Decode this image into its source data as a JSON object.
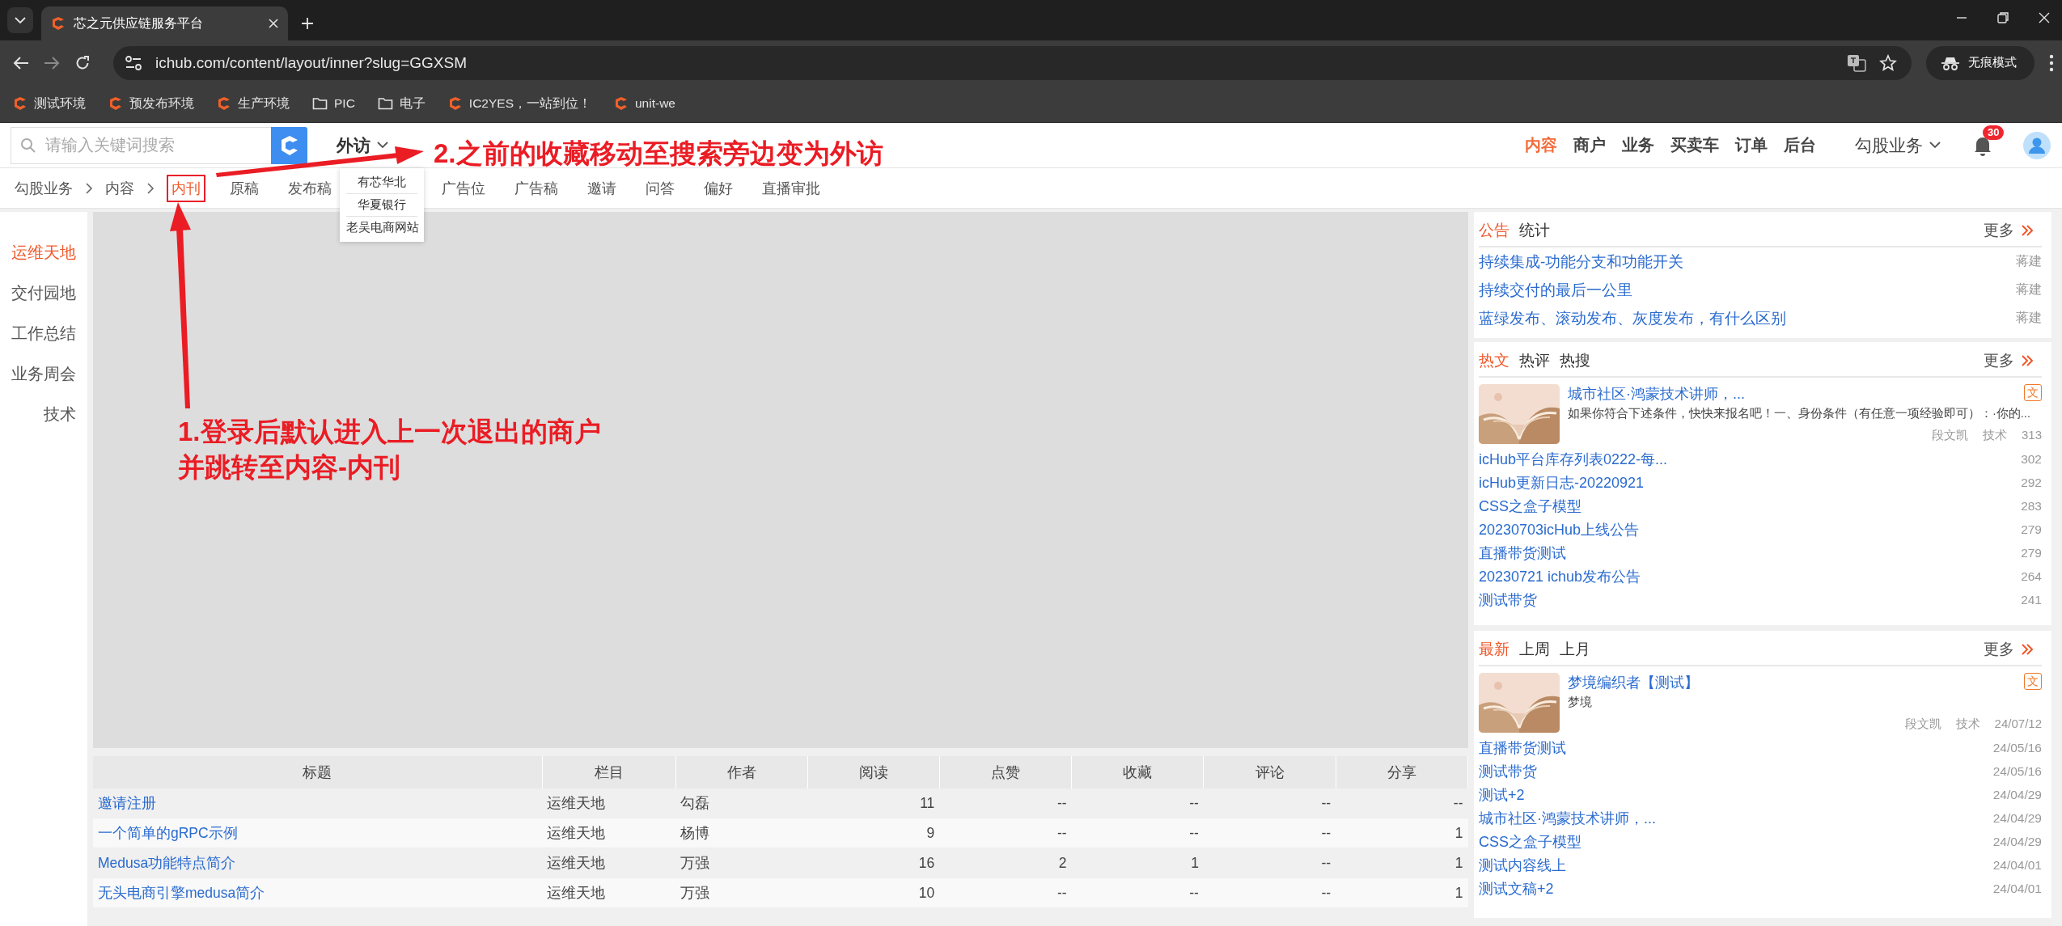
{
  "browser": {
    "tab_title": "芯之元供应链服务平台",
    "address": "ichub.com/content/layout/inner?slug=GGXSM",
    "profile": "无痕模式",
    "bookmarks": [
      {
        "kind": "site",
        "label": "测试环境"
      },
      {
        "kind": "site",
        "label": "预发布环境"
      },
      {
        "kind": "site",
        "label": "生产环境"
      },
      {
        "kind": "folder",
        "label": "PIC"
      },
      {
        "kind": "folder",
        "label": "电子"
      },
      {
        "kind": "site",
        "label": "IC2YES，一站到位！"
      },
      {
        "kind": "site",
        "label": "unit-we"
      }
    ]
  },
  "header": {
    "search": {
      "placeholder": "请输入关键词搜索"
    },
    "visit": {
      "label": "外访",
      "expanded": true,
      "options": [
        {
          "label": "有芯华北"
        },
        {
          "label": "华夏银行"
        },
        {
          "label": "老吴电商网站"
        }
      ]
    },
    "nav": [
      {
        "label": "内容",
        "selected": true
      },
      {
        "label": "商户",
        "selected": false
      },
      {
        "label": "业务",
        "selected": false
      },
      {
        "label": "买卖车",
        "selected": false
      },
      {
        "label": "订单",
        "selected": false
      },
      {
        "label": "后台",
        "selected": false
      }
    ],
    "org": "勾股业务",
    "notifications": "30"
  },
  "subnav": {
    "breadcrumb": [
      "勾股业务",
      "内容"
    ],
    "tabs": [
      {
        "label": "内刊",
        "selected": true
      },
      {
        "label": "原稿",
        "selected": false
      },
      {
        "label": "发布稿",
        "selected": false
      },
      {
        "label": "广告位",
        "selected": false
      },
      {
        "label": "广告稿",
        "selected": false
      },
      {
        "label": "邀请",
        "selected": false
      },
      {
        "label": "问答",
        "selected": false
      },
      {
        "label": "偏好",
        "selected": false
      },
      {
        "label": "直播审批",
        "selected": false
      }
    ]
  },
  "sidebar": {
    "items": [
      {
        "label": "运维天地",
        "selected": true
      },
      {
        "label": "交付园地",
        "selected": false
      },
      {
        "label": "工作总结",
        "selected": false
      },
      {
        "label": "业务周会",
        "selected": false
      },
      {
        "label": "技术",
        "selected": false
      }
    ]
  },
  "table": {
    "columns": [
      "标题",
      "栏目",
      "作者",
      "阅读",
      "点赞",
      "收藏",
      "评论",
      "分享"
    ],
    "rows": [
      [
        "邀请注册",
        "运维天地",
        "勾磊",
        "11",
        "--",
        "--",
        "--",
        "--"
      ],
      [
        "一个简单的gRPC示例",
        "运维天地",
        "杨博",
        "9",
        "--",
        "--",
        "--",
        "1"
      ],
      [
        "Medusa功能特点简介",
        "运维天地",
        "万强",
        "16",
        "2",
        "1",
        "--",
        "1"
      ],
      [
        "无头电商引擎medusa简介",
        "运维天地",
        "万强",
        "10",
        "--",
        "--",
        "--",
        "1"
      ]
    ]
  },
  "right_panel": {
    "cards": [
      {
        "tabs": [
          {
            "label": "公告",
            "selected": true
          },
          {
            "label": "统计",
            "selected": false
          }
        ],
        "more": "更多",
        "items": [
          {
            "title": "持续集成-功能分支和功能开关",
            "meta": "蒋建"
          },
          {
            "title": "持续交付的最后一公里",
            "meta": "蒋建"
          },
          {
            "title": "蓝绿发布、滚动发布、灰度发布，有什么区别",
            "meta": "蒋建"
          }
        ]
      },
      {
        "tabs": [
          {
            "label": "热文",
            "selected": true
          },
          {
            "label": "热评",
            "selected": false
          },
          {
            "label": "热搜",
            "selected": false
          }
        ],
        "more": "更多",
        "featured": {
          "title": "城市社区·鸿蒙技术讲师，...",
          "summary": "如果你符合下述条件，快快来报名吧！一、身份条件（有任意一项经验即可）：·你的...",
          "badge": "文",
          "author": "段文凯",
          "category": "技术",
          "meta": "313"
        },
        "items": [
          {
            "title": "icHub平台库存列表0222-每...",
            "meta": "302"
          },
          {
            "title": "icHub更新日志-20220921",
            "meta": "292"
          },
          {
            "title": "CSS之盒子模型",
            "meta": "283"
          },
          {
            "title": "20230703icHub上线公告",
            "meta": "279"
          },
          {
            "title": "直播带货测试",
            "meta": "279"
          },
          {
            "title": "20230721 ichub发布公告",
            "meta": "264"
          },
          {
            "title": "测试带货",
            "meta": "241"
          }
        ]
      },
      {
        "tabs": [
          {
            "label": "最新",
            "selected": true
          },
          {
            "label": "上周",
            "selected": false
          },
          {
            "label": "上月",
            "selected": false
          }
        ],
        "more": "更多",
        "featured": {
          "title": "梦境编织者【测试】",
          "summary": "梦境",
          "badge": "文",
          "author": "段文凯",
          "category": "技术",
          "meta": "24/07/12"
        },
        "items": [
          {
            "title": "直播带货测试",
            "meta": "24/05/16"
          },
          {
            "title": "测试带货",
            "meta": "24/05/16"
          },
          {
            "title": "测试+2",
            "meta": "24/04/29"
          },
          {
            "title": "城市社区·鸿蒙技术讲师，...",
            "meta": "24/04/29"
          },
          {
            "title": "CSS之盒子模型",
            "meta": "24/04/29"
          },
          {
            "title": "测试内容线上",
            "meta": "24/04/01"
          },
          {
            "title": "测试文稿+2",
            "meta": "24/04/01"
          }
        ]
      }
    ]
  },
  "annotations": [
    {
      "lines": [
        "1.登录后默认进入上一次退出的商户",
        "并跳转至内容-内刊"
      ]
    },
    {
      "lines": [
        "2.之前的收藏移动至搜索旁边变为外访"
      ]
    }
  ]
}
